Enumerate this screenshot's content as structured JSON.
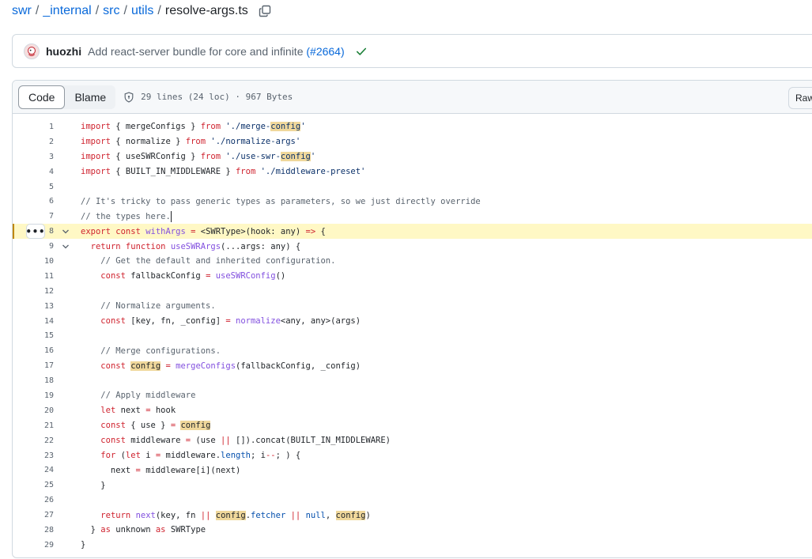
{
  "breadcrumb": {
    "parts": [
      "swr",
      "_internal",
      "src",
      "utils"
    ],
    "separator": "/",
    "file": "resolve-args.ts"
  },
  "commit": {
    "author": "huozhi",
    "message": "Add react-server bundle for core and infinite",
    "pr": "(#2664)",
    "status": "success"
  },
  "toolbar": {
    "code_label": "Code",
    "blame_label": "Blame",
    "file_info": "29 lines (24 loc) · 967 Bytes",
    "raw_label": "Raw"
  },
  "colors": {
    "link": "#0969da",
    "keyword": "#cf222e",
    "string": "#0a3069",
    "function": "#8250df",
    "comment": "#59636e",
    "highlight_line": "#fff8c5",
    "search_match": "#f0d89b",
    "check": "#1a7f37"
  },
  "code": {
    "highlighted_line": 8,
    "search_term": "config",
    "lines": [
      [
        [
          "k",
          "import"
        ],
        [
          "t",
          " { mergeConfigs } "
        ],
        [
          "k",
          "from"
        ],
        [
          "t",
          " "
        ],
        [
          "s",
          "'./merge-"
        ],
        [
          "ms",
          "config"
        ],
        [
          "s",
          "'"
        ]
      ],
      [
        [
          "k",
          "import"
        ],
        [
          "t",
          " { normalize } "
        ],
        [
          "k",
          "from"
        ],
        [
          "t",
          " "
        ],
        [
          "s",
          "'./normalize-args'"
        ]
      ],
      [
        [
          "k",
          "import"
        ],
        [
          "t",
          " { useSWRConfig } "
        ],
        [
          "k",
          "from"
        ],
        [
          "t",
          " "
        ],
        [
          "s",
          "'./use-swr-"
        ],
        [
          "ms",
          "config"
        ],
        [
          "s",
          "'"
        ]
      ],
      [
        [
          "k",
          "import"
        ],
        [
          "t",
          " { BUILT_IN_MIDDLEWARE } "
        ],
        [
          "k",
          "from"
        ],
        [
          "t",
          " "
        ],
        [
          "s",
          "'./middleware-preset'"
        ]
      ],
      [],
      [
        [
          "c",
          "// It's tricky to pass generic types as parameters, so we just directly override"
        ]
      ],
      [
        [
          "c",
          "// the types here."
        ]
      ],
      [
        [
          "k",
          "export"
        ],
        [
          "t",
          " "
        ],
        [
          "k",
          "const"
        ],
        [
          "t",
          " "
        ],
        [
          "f",
          "withArgs"
        ],
        [
          "t",
          " "
        ],
        [
          "k",
          "="
        ],
        [
          "t",
          " <SWRType>(hook: any) "
        ],
        [
          "k",
          "=>"
        ],
        [
          "t",
          " {"
        ]
      ],
      [
        [
          "t",
          "  "
        ],
        [
          "k",
          "return"
        ],
        [
          "t",
          " "
        ],
        [
          "k",
          "function"
        ],
        [
          "t",
          " "
        ],
        [
          "f",
          "useSWRArgs"
        ],
        [
          "t",
          "(...args: any) {"
        ]
      ],
      [
        [
          "t",
          "    "
        ],
        [
          "c",
          "// Get the default and inherited configuration."
        ]
      ],
      [
        [
          "t",
          "    "
        ],
        [
          "k",
          "const"
        ],
        [
          "t",
          " fallbackConfig "
        ],
        [
          "k",
          "="
        ],
        [
          "t",
          " "
        ],
        [
          "f",
          "useSWRConfig"
        ],
        [
          "t",
          "()"
        ]
      ],
      [],
      [
        [
          "t",
          "    "
        ],
        [
          "c",
          "// Normalize arguments."
        ]
      ],
      [
        [
          "t",
          "    "
        ],
        [
          "k",
          "const"
        ],
        [
          "t",
          " [key, fn, _config] "
        ],
        [
          "k",
          "="
        ],
        [
          "t",
          " "
        ],
        [
          "f",
          "normalize"
        ],
        [
          "t",
          "<any, any>(args)"
        ]
      ],
      [],
      [
        [
          "t",
          "    "
        ],
        [
          "c",
          "// Merge configurations."
        ]
      ],
      [
        [
          "t",
          "    "
        ],
        [
          "k",
          "const"
        ],
        [
          "t",
          " "
        ],
        [
          "m",
          "config"
        ],
        [
          "t",
          " "
        ],
        [
          "k",
          "="
        ],
        [
          "t",
          " "
        ],
        [
          "f",
          "mergeConfigs"
        ],
        [
          "t",
          "(fallbackConfig, _config)"
        ]
      ],
      [],
      [
        [
          "t",
          "    "
        ],
        [
          "c",
          "// Apply middleware"
        ]
      ],
      [
        [
          "t",
          "    "
        ],
        [
          "k",
          "let"
        ],
        [
          "t",
          " next "
        ],
        [
          "k",
          "="
        ],
        [
          "t",
          " hook"
        ]
      ],
      [
        [
          "t",
          "    "
        ],
        [
          "k",
          "const"
        ],
        [
          "t",
          " { use } "
        ],
        [
          "k",
          "="
        ],
        [
          "t",
          " "
        ],
        [
          "m",
          "config"
        ]
      ],
      [
        [
          "t",
          "    "
        ],
        [
          "k",
          "const"
        ],
        [
          "t",
          " middleware "
        ],
        [
          "k",
          "="
        ],
        [
          "t",
          " (use "
        ],
        [
          "k",
          "||"
        ],
        [
          "t",
          " []).concat(BUILT_IN_MIDDLEWARE)"
        ]
      ],
      [
        [
          "t",
          "    "
        ],
        [
          "k",
          "for"
        ],
        [
          "t",
          " ("
        ],
        [
          "k",
          "let"
        ],
        [
          "t",
          " i "
        ],
        [
          "k",
          "="
        ],
        [
          "t",
          " middleware."
        ],
        [
          "p",
          "length"
        ],
        [
          "t",
          "; i"
        ],
        [
          "k",
          "--"
        ],
        [
          "t",
          "; ) {"
        ]
      ],
      [
        [
          "t",
          "      next "
        ],
        [
          "k",
          "="
        ],
        [
          "t",
          " middleware[i](next)"
        ]
      ],
      [
        [
          "t",
          "    }"
        ]
      ],
      [],
      [
        [
          "t",
          "    "
        ],
        [
          "k",
          "return"
        ],
        [
          "t",
          " "
        ],
        [
          "f",
          "next"
        ],
        [
          "t",
          "(key, fn "
        ],
        [
          "k",
          "||"
        ],
        [
          "t",
          " "
        ],
        [
          "m",
          "config"
        ],
        [
          "t",
          "."
        ],
        [
          "p",
          "fetcher"
        ],
        [
          "t",
          " "
        ],
        [
          "k",
          "||"
        ],
        [
          "t",
          " "
        ],
        [
          "p",
          "null"
        ],
        [
          "t",
          ", "
        ],
        [
          "m",
          "config"
        ],
        [
          "t",
          ")"
        ]
      ],
      [
        [
          "t",
          "  } "
        ],
        [
          "k",
          "as"
        ],
        [
          "t",
          " unknown "
        ],
        [
          "k",
          "as"
        ],
        [
          "t",
          " SWRType"
        ]
      ],
      [
        [
          "t",
          "}"
        ]
      ]
    ]
  }
}
